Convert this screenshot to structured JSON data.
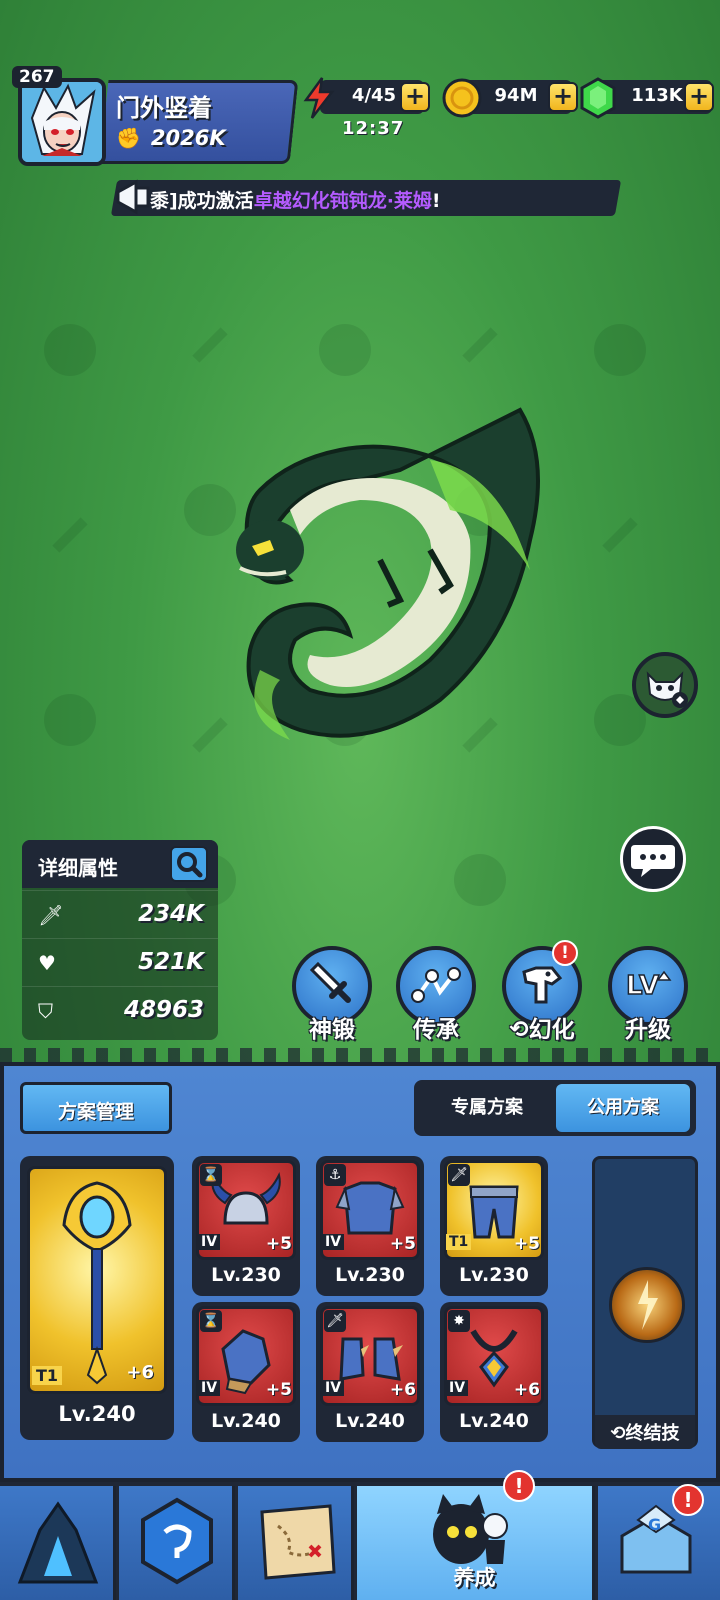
{
  "player": {
    "level": "267",
    "name": "门外竖着",
    "power": "2026K"
  },
  "resources": {
    "energy": "4/45",
    "energy_timer": "12:37",
    "gold": "94M",
    "gems": "113K"
  },
  "announcement": {
    "prefix": "黍]成功激活",
    "highlight": "卓越幻化钝钝龙·莱姆",
    "suffix": "!"
  },
  "stats": {
    "title": "详细属性",
    "attack": "234K",
    "hp": "521K",
    "defense": "48963"
  },
  "actions": [
    {
      "label": "神锻",
      "icon": "sword-icon"
    },
    {
      "label": "传承",
      "icon": "nodes-icon"
    },
    {
      "label": "幻化",
      "icon": "dragon-head-icon",
      "alert": "!"
    },
    {
      "label": "升级",
      "icon": "lv-up-icon"
    }
  ],
  "plan": {
    "manage_label": "方案管理",
    "tabs": [
      "专属方案",
      "公用方案"
    ],
    "active_tab": 1
  },
  "weapon": {
    "tier": "T1",
    "plus": "+6",
    "level": "Lv.240"
  },
  "equipment": [
    {
      "tier": "IV",
      "plus": "+5",
      "level": "Lv.230",
      "type": "hourglass-icon",
      "gold": false
    },
    {
      "tier": "IV",
      "plus": "+5",
      "level": "Lv.230",
      "type": "anchor-icon",
      "gold": false
    },
    {
      "tier": "T1",
      "plus": "+5",
      "level": "Lv.230",
      "type": "sword-icon",
      "gold": true
    },
    {
      "tier": "IV",
      "plus": "+5",
      "level": "Lv.240",
      "type": "hourglass-icon",
      "gold": false
    },
    {
      "tier": "IV",
      "plus": "+6",
      "level": "Lv.240",
      "type": "sword-icon",
      "gold": false
    },
    {
      "tier": "IV",
      "plus": "+6",
      "level": "Lv.240",
      "type": "burst-icon",
      "gold": false
    }
  ],
  "ultimate": {
    "label": "终结技"
  },
  "nav": {
    "active_label": "养成",
    "alert": "!"
  },
  "colors": {
    "bg_green": "#3f9a45",
    "panel_blue": "#3f72c2",
    "dark": "#1f2736",
    "highlight_purple": "#b45bff",
    "alert_red": "#e3342f"
  }
}
